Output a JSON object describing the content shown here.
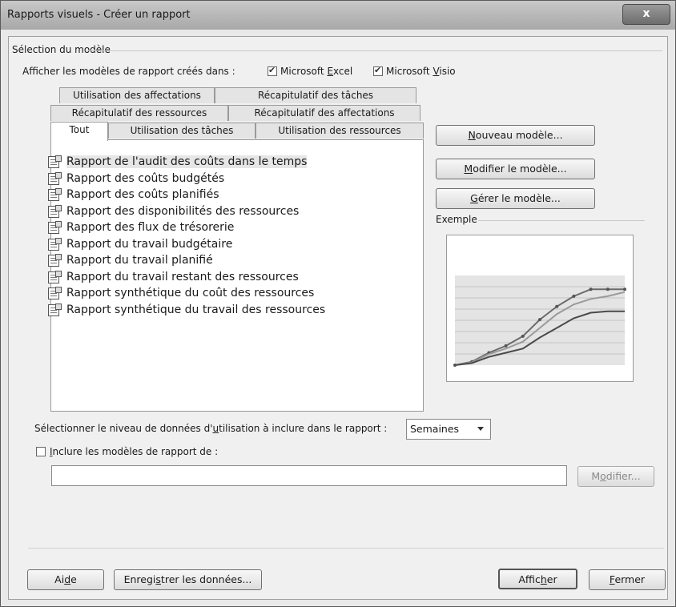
{
  "window": {
    "title": "Rapports visuels - Créer un rapport",
    "close_glyph": "x"
  },
  "template_group": {
    "label": "Sélection du modèle",
    "show_label": "Afficher les modèles de rapport créés dans :",
    "excel_label": "Microsoft Excel",
    "excel_checked": true,
    "visio_label": "Microsoft Visio",
    "visio_checked": true
  },
  "tabs": {
    "row1": [
      "Utilisation des affectations",
      "Récapitulatif des tâches"
    ],
    "row2": [
      "Récapitulatif des ressources",
      "Récapitulatif des affectations"
    ],
    "row3": [
      "Tout",
      "Utilisation des tâches",
      "Utilisation des ressources"
    ],
    "active": "Tout"
  },
  "reports": [
    "Rapport de l'audit des coûts dans le temps",
    "Rapport des coûts budgétés",
    "Rapport des coûts planifiés",
    "Rapport des disponibilités des ressources",
    "Rapport des flux de trésorerie",
    "Rapport du travail budgétaire",
    "Rapport du travail planifié",
    "Rapport du travail restant des ressources",
    "Rapport synthétique du coût des ressources",
    "Rapport synthétique du travail des ressources"
  ],
  "selected_report_index": 0,
  "side_buttons": {
    "new_template": "Nouveau modèle...",
    "edit_template": "Modifier le modèle...",
    "manage_template": "Gérer le modèle..."
  },
  "example_label": "Exemple",
  "chart_data": {
    "type": "line",
    "x": [
      1,
      2,
      3,
      4,
      5,
      6,
      7,
      8,
      9,
      10,
      11
    ],
    "series": [
      {
        "values": [
          0,
          5,
          18,
          28,
          42,
          66,
          85,
          100,
          110,
          110,
          110
        ]
      },
      {
        "values": [
          0,
          4,
          16,
          24,
          34,
          54,
          74,
          88,
          96,
          100,
          106
        ]
      },
      {
        "values": [
          0,
          3,
          12,
          18,
          24,
          40,
          54,
          68,
          76,
          78,
          78
        ]
      }
    ],
    "ylim": [
      0,
      130
    ],
    "grid": true
  },
  "usage_level": {
    "label": "Sélectionner le niveau de données d'utilisation à inclure dans le rapport :",
    "value": "Semaines"
  },
  "include_templates": {
    "label": "Inclure les modèles de rapport de :",
    "checked": false,
    "path": "",
    "modify_button": "Modifier..."
  },
  "footer": {
    "help": "Aide",
    "save_data": "Enregistrer les données...",
    "show": "Afficher",
    "close": "Fermer"
  }
}
